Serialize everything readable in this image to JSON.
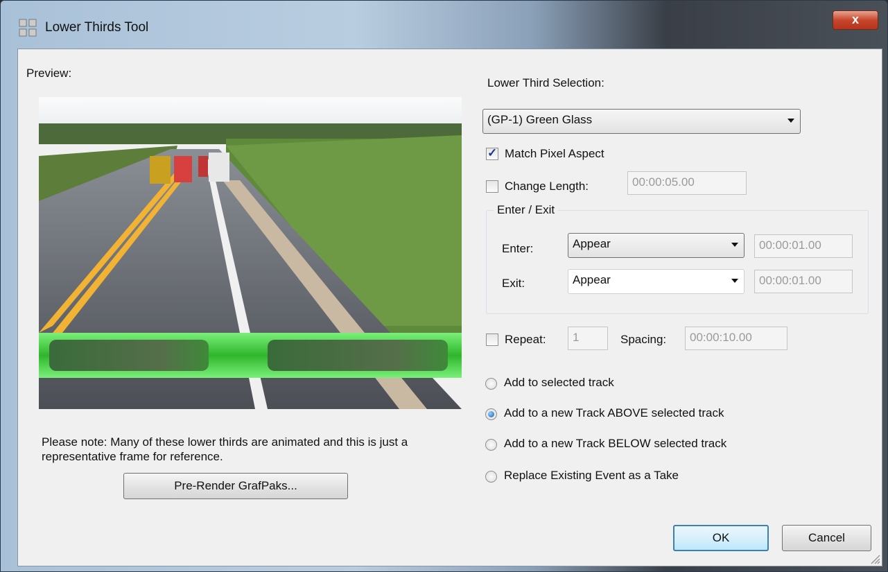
{
  "window": {
    "title": "Lower Thirds Tool",
    "close_label": "x"
  },
  "preview": {
    "label": "Preview:",
    "note": "Please note: Many of these lower thirds are animated and this is just a representative frame for reference.",
    "prerender_label": "Pre-Render GrafPaks..."
  },
  "selection": {
    "label": "Lower Third Selection:",
    "value": "(GP-1) Green Glass"
  },
  "match_pixel_aspect": {
    "label": "Match Pixel Aspect",
    "checked": true
  },
  "change_length": {
    "label": "Change Length:",
    "checked": false,
    "value": "00:00:05.00"
  },
  "enter_exit": {
    "group_label": "Enter / Exit",
    "enter": {
      "label": "Enter:",
      "value": "Appear",
      "time": "00:00:01.00"
    },
    "exit": {
      "label": "Exit:",
      "value": "Appear",
      "time": "00:00:01.00"
    }
  },
  "repeat": {
    "label": "Repeat:",
    "checked": false,
    "value": "1",
    "spacing_label": "Spacing:",
    "spacing_value": "00:00:10.00"
  },
  "placement": {
    "options": [
      {
        "label": "Add to selected track",
        "selected": false
      },
      {
        "label": "Add to a new Track ABOVE selected track",
        "selected": true
      },
      {
        "label": "Add to a new Track BELOW selected track",
        "selected": false
      },
      {
        "label": "Replace Existing Event as a Take",
        "selected": false
      }
    ]
  },
  "buttons": {
    "ok": "OK",
    "cancel": "Cancel"
  },
  "colors": {
    "accent_green": "#3fd13a",
    "default_button_border": "#3c7fb1",
    "close_red": "#c8462d"
  }
}
